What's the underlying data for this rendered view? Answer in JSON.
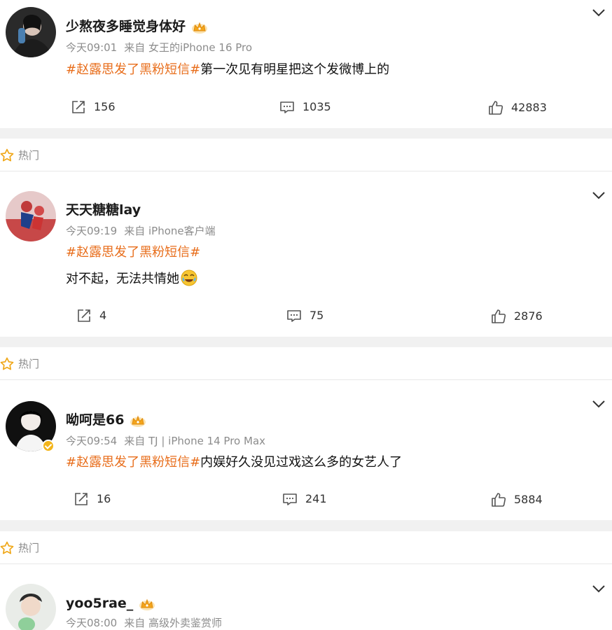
{
  "hot_label": "热门",
  "posts": [
    {
      "username": "少熬夜多睡觉身体好",
      "time": "今天09:01",
      "source": "来自 女王的iPhone 16 Pro",
      "topic": "#赵露思发了黑粉短信#",
      "text": "第一次见有明星把这个发微博上的",
      "text2": "",
      "reposts": "156",
      "comments": "1035",
      "likes": "42883"
    },
    {
      "username": "天天糖糖lay",
      "time": "今天09:19",
      "source": "来自 iPhone客户端",
      "topic": "#赵露思发了黑粉短信#",
      "text": "",
      "text2": "对不起，无法共情她",
      "reposts": "4",
      "comments": "75",
      "likes": "2876"
    },
    {
      "username": "呦呵是66",
      "time": "今天09:54",
      "source": "来自 TJ | iPhone 14 Pro Max",
      "topic": "#赵露思发了黑粉短信#",
      "text": "内娱好久没见过戏这么多的女艺人了",
      "text2": "",
      "reposts": "16",
      "comments": "241",
      "likes": "5884"
    },
    {
      "username": "yoo5rae_",
      "time": "今天08:00",
      "source": "来自 高级外卖鉴赏师"
    }
  ],
  "colors": {
    "topic": "#e86e1c",
    "crown": "#f3b51b",
    "separator": "#f1f1f1"
  },
  "icons": {
    "repost": "repost-icon",
    "comment": "comment-icon",
    "like": "like-icon",
    "more": "chevron-down-icon",
    "hot": "star-icon",
    "crown": "crown-icon",
    "verified": "verified-badge-icon",
    "emoji": "crying-laughing-emoji"
  }
}
